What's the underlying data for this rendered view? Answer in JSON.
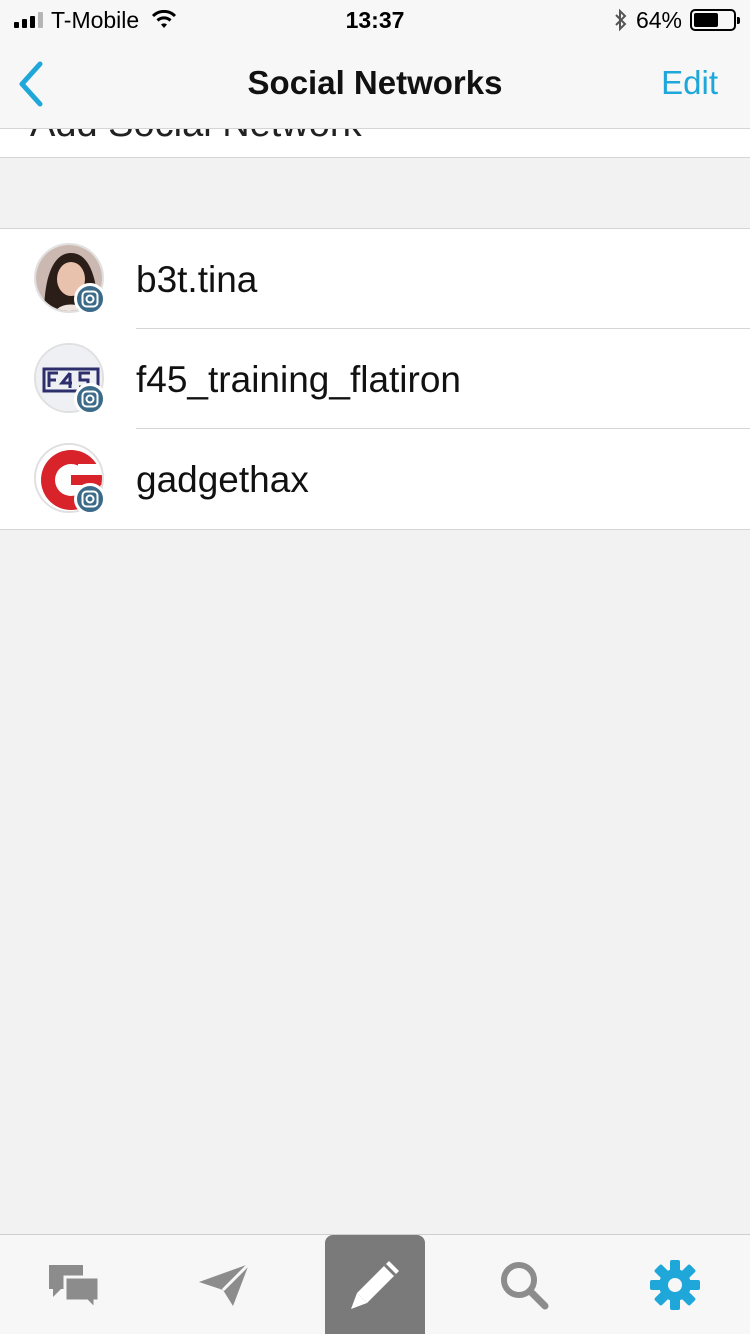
{
  "status_bar": {
    "carrier": "T-Mobile",
    "time": "13:37",
    "battery_percent": "64%",
    "battery_level": 0.64
  },
  "nav": {
    "title": "Social Networks",
    "edit_label": "Edit",
    "back_icon": "chevron-left-icon"
  },
  "add_row": {
    "label": "Add Social Network"
  },
  "accounts": [
    {
      "name": "b3t.tina",
      "network": "instagram"
    },
    {
      "name": "f45_training_flatiron",
      "network": "instagram"
    },
    {
      "name": "gadgethax",
      "network": "instagram"
    }
  ],
  "tab_bar": {
    "tabs": [
      {
        "icon": "chat-bubbles-icon"
      },
      {
        "icon": "paper-plane-icon"
      },
      {
        "icon": "pencil-icon",
        "selected_background": true
      },
      {
        "icon": "search-icon"
      },
      {
        "icon": "gear-icon",
        "active": true
      }
    ]
  },
  "colors": {
    "accent": "#1ea7d8",
    "instagram_badge": "#3c6b8a",
    "background": "#f2f2f2"
  }
}
